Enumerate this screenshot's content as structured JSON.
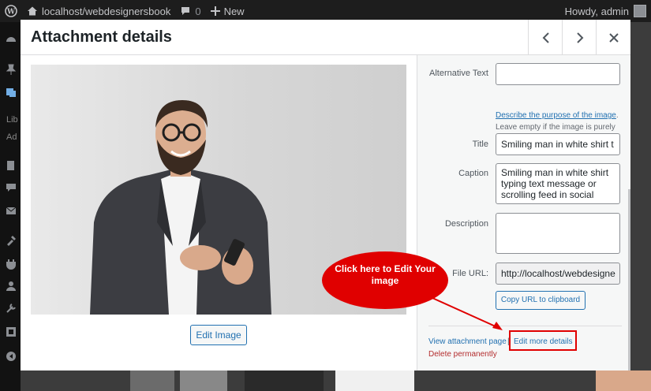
{
  "adminbar": {
    "site_label": "localhost/webdesignersbook",
    "comments_count": "0",
    "new_label": "New",
    "howdy_label": "Howdy, admin"
  },
  "sidemenu": {
    "sub_items": [
      "Lib",
      "Ad"
    ]
  },
  "modal": {
    "title": "Attachment details"
  },
  "details": {
    "alt_label": "Alternative Text",
    "alt_value": "",
    "alt_help_link": "Describe the purpose of the image",
    "alt_help_rest": "Leave empty if the image is purely decorative.",
    "title_label": "Title",
    "title_value": "Smiling man in white shirt t",
    "caption_label": "Caption",
    "caption_value": "Smiling man in white shirt typing text message or scrolling feed in social",
    "description_label": "Description",
    "description_value": "",
    "file_url_label": "File URL:",
    "file_url_value": "http://localhost/webdesigne",
    "copy_button": "Copy URL to clipboard",
    "view_link": "View attachment page",
    "edit_more_link": "Edit more details",
    "delete_link": "Delete permanently"
  },
  "preview": {
    "edit_button": "Edit Image"
  },
  "annotation": {
    "callout_text": "Click here to Edit Your image",
    "color": "#e00000"
  },
  "colors": {
    "link": "#2271b1",
    "danger": "#b32d2e",
    "adminbar_bg": "#1d1d1d"
  }
}
